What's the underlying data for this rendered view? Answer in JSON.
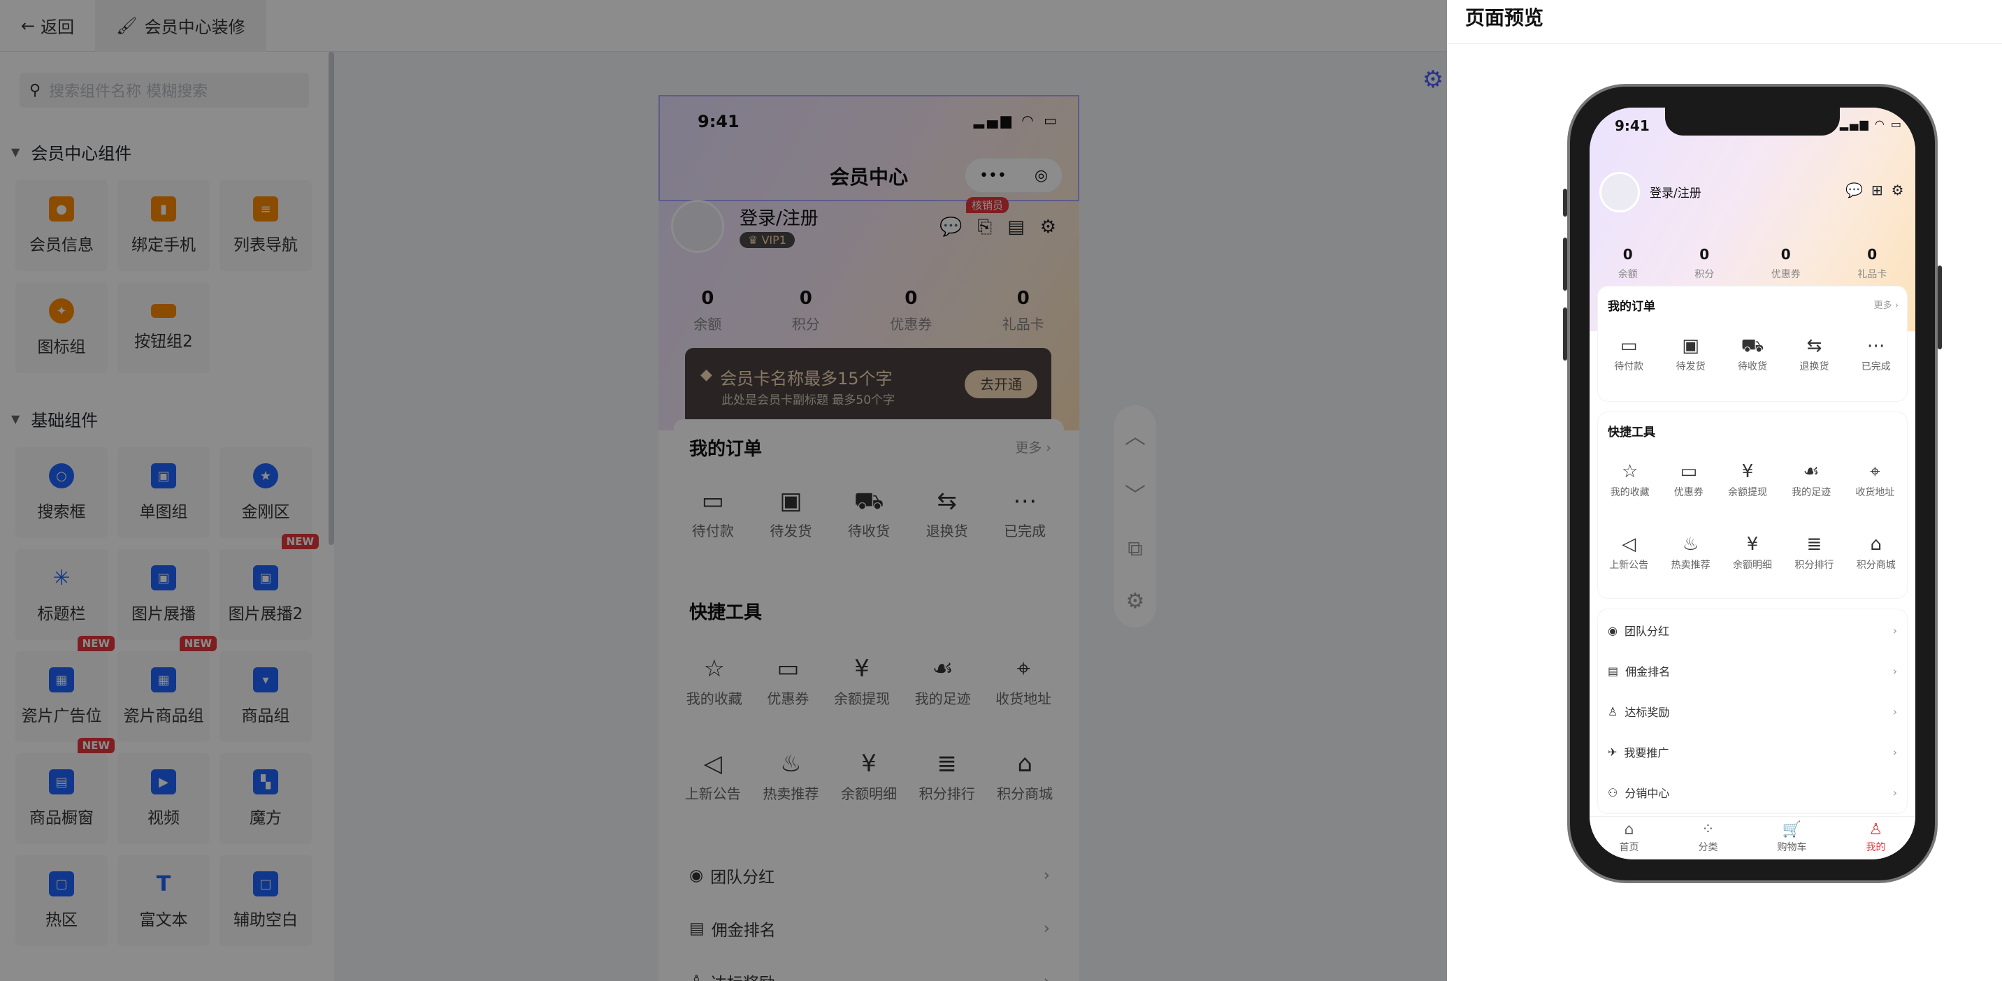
{
  "topbar": {
    "back_label": "返回",
    "tab_label": "会员中心装修"
  },
  "left_panel": {
    "search_placeholder": "搜索组件名称 模糊搜索",
    "section1_title": "会员中心组件",
    "section1_items": [
      "会员信息",
      "绑定手机",
      "列表导航",
      "图标组",
      "按钮组2"
    ],
    "section2_title": "基础组件",
    "section2_items": [
      "搜索框",
      "单图组",
      "金刚区",
      "标题栏",
      "图片展播",
      "图片展播2",
      "瓷片广告位",
      "瓷片商品组",
      "商品组",
      "商品橱窗",
      "视频",
      "魔方",
      "热区",
      "富文本",
      "辅助空白"
    ],
    "new_badge": "NEW"
  },
  "editor": {
    "time": "9:41",
    "title": "会员中心",
    "capsule_dots": "•••",
    "login_text": "登录/注册",
    "vip_tag": "VIP1",
    "verifier_badge": "核销员",
    "stats": [
      {
        "value": "0",
        "label": "余额"
      },
      {
        "value": "0",
        "label": "积分"
      },
      {
        "value": "0",
        "label": "优惠券"
      },
      {
        "value": "0",
        "label": "礼品卡"
      }
    ],
    "vip_card": {
      "name": "会员卡名称最多15个字",
      "subtitle": "此处是会员卡副标题 最多50个字",
      "button": "去开通"
    },
    "orders": {
      "title": "我的订单",
      "more": "更多",
      "items": [
        "待付款",
        "待发货",
        "待收货",
        "退换货",
        "已完成"
      ]
    },
    "tools": {
      "title": "快捷工具",
      "row1": [
        "我的收藏",
        "优惠券",
        "余额提现",
        "我的足迹",
        "收货地址"
      ],
      "row2": [
        "上新公告",
        "热卖推荐",
        "余额明细",
        "积分排行",
        "积分商城"
      ]
    },
    "list": [
      "团队分红",
      "佣金排名",
      "达标奖励"
    ]
  },
  "preview": {
    "title": "页面预览",
    "time": "9:41",
    "login_text": "登录/注册",
    "stats": [
      {
        "value": "0",
        "label": "余额"
      },
      {
        "value": "0",
        "label": "积分"
      },
      {
        "value": "0",
        "label": "优惠券"
      },
      {
        "value": "0",
        "label": "礼品卡"
      }
    ],
    "orders": {
      "title": "我的订单",
      "more": "更多",
      "items": [
        "待付款",
        "待发货",
        "待收货",
        "退换货",
        "已完成"
      ]
    },
    "tools": {
      "title": "快捷工具",
      "row1": [
        "我的收藏",
        "优惠券",
        "余额提现",
        "我的足迹",
        "收货地址"
      ],
      "row2": [
        "上新公告",
        "热卖推荐",
        "余额明细",
        "积分排行",
        "积分商城"
      ]
    },
    "list": [
      "团队分红",
      "佣金排名",
      "达标奖励",
      "我要推广",
      "分销中心"
    ],
    "tabbar": [
      "首页",
      "分类",
      "购物车",
      "我的"
    ]
  },
  "colors": {
    "accent": "#4a5cff",
    "danger": "#e8383d",
    "vip_card_bg": "#4b4340"
  }
}
